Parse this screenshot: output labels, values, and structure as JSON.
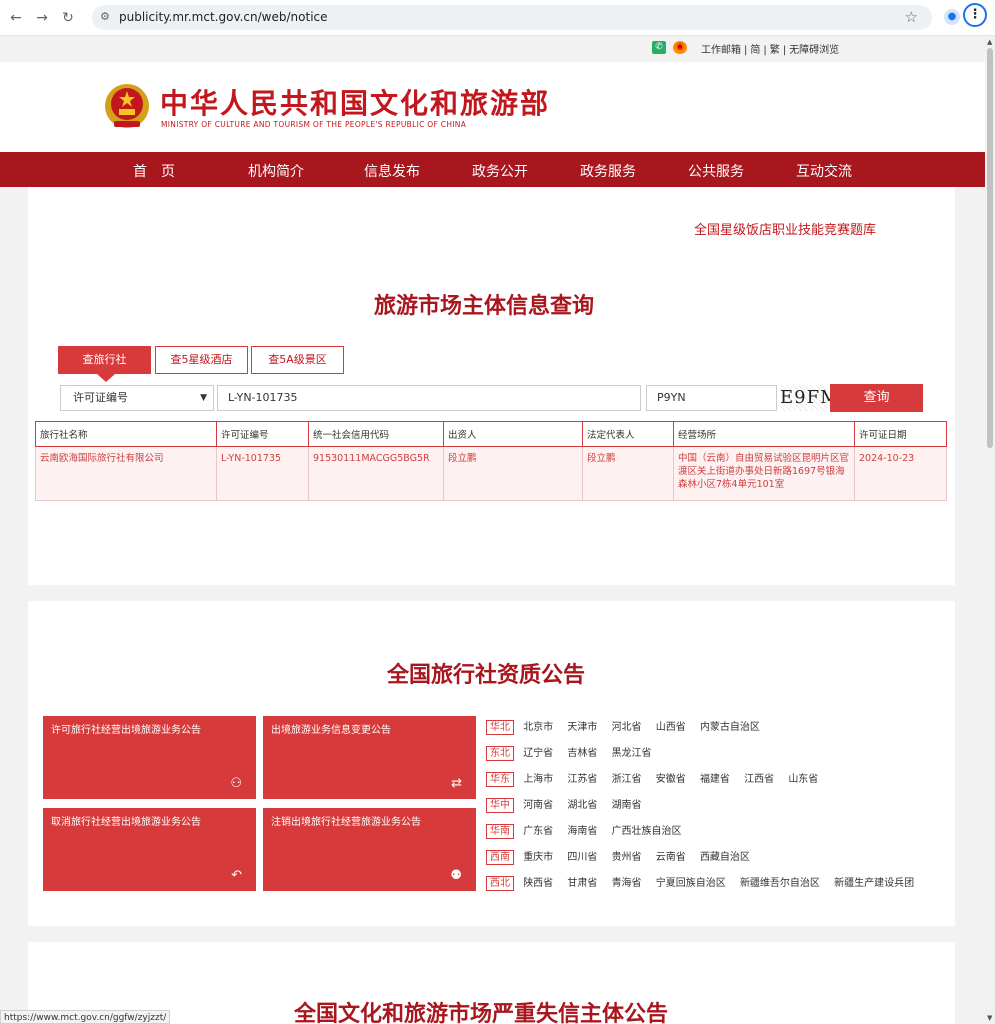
{
  "browser": {
    "url": "publicity.mr.mct.gov.cn/web/notice",
    "status_url": "https://www.mct.gov.cn/ggfw/zyjzzt/"
  },
  "utility": {
    "links": [
      "工作邮箱",
      "简",
      "繁",
      "无障碍浏览"
    ]
  },
  "header": {
    "title": "中华人民共和国文化和旅游部",
    "subtitle": "MINISTRY OF CULTURE AND TOURISM OF THE PEOPLE'S REPUBLIC OF CHINA"
  },
  "nav": [
    "首　页",
    "机构简介",
    "信息发布",
    "政务公开",
    "政务服务",
    "公共服务",
    "互动交流"
  ],
  "contest_link": "全国星级饭店职业技能竞赛题库",
  "query_section": {
    "title": "旅游市场主体信息查询",
    "tabs": [
      "查旅行社",
      "查5星级酒店",
      "查5A级景区"
    ],
    "active_tab": 0,
    "search_type": "许可证编号",
    "search_value": "L-YN-101735",
    "captcha_input": "P9YN",
    "captcha_image": "E9FM",
    "query_button": "查询",
    "columns": [
      "旅行社名称",
      "许可证编号",
      "统一社会信用代码",
      "出资人",
      "法定代表人",
      "经营场所",
      "许可证日期"
    ],
    "rows": [
      [
        "云南欧海国际旅行社有限公司",
        "L-YN-101735",
        "91530111MACGG5BG5R",
        "段立鹏",
        "段立鹏",
        "中国（云南）自由贸易试验区昆明片区官渡区关上街道办事处日新路1697号银海森林小区7栋4单元101室",
        "2024-10-23"
      ]
    ]
  },
  "qualification_section": {
    "title": "全国旅行社资质公告",
    "cards": [
      {
        "label": "许可旅行社经营出境旅游业务公告",
        "icon": "person-check-icon"
      },
      {
        "label": "出境旅游业务信息变更公告",
        "icon": "swap-icon"
      },
      {
        "label": "取消旅行社经营出境旅游业务公告",
        "icon": "undo-icon"
      },
      {
        "label": "注销出境旅行社经营旅游业务公告",
        "icon": "family-icon"
      }
    ],
    "regions": [
      {
        "name": "华北",
        "provinces": [
          "北京市",
          "天津市",
          "河北省",
          "山西省",
          "内蒙古自治区"
        ]
      },
      {
        "name": "东北",
        "provinces": [
          "辽宁省",
          "吉林省",
          "黑龙江省"
        ]
      },
      {
        "name": "华东",
        "provinces": [
          "上海市",
          "江苏省",
          "浙江省",
          "安徽省",
          "福建省",
          "江西省",
          "山东省"
        ]
      },
      {
        "name": "华中",
        "provinces": [
          "河南省",
          "湖北省",
          "湖南省"
        ]
      },
      {
        "name": "华南",
        "provinces": [
          "广东省",
          "海南省",
          "广西壮族自治区"
        ]
      },
      {
        "name": "西南",
        "provinces": [
          "重庆市",
          "四川省",
          "贵州省",
          "云南省",
          "西藏自治区"
        ]
      },
      {
        "name": "西北",
        "provinces": [
          "陕西省",
          "甘肃省",
          "青海省",
          "宁夏回族自治区",
          "新疆维吾尔自治区",
          "新疆生产建设兵团"
        ]
      }
    ]
  },
  "blacklist_section": {
    "title": "全国文化和旅游市场严重失信主体公告"
  },
  "colors": {
    "brand_red": "#a8161e",
    "accent_red": "#d73a3a"
  }
}
